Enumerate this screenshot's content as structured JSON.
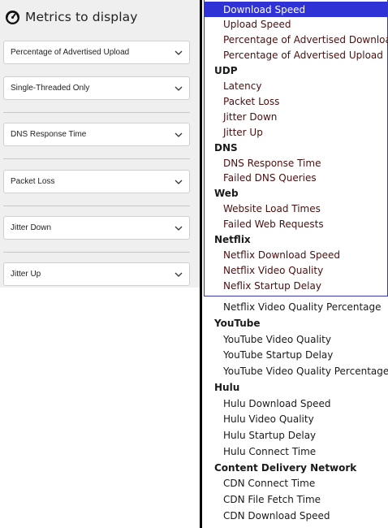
{
  "settings_panel": {
    "title": "Metrics to display",
    "icon": "gauge-icon",
    "selects": [
      {
        "value": "Percentage of Advertised Upload"
      },
      {
        "value": "Single-Threaded Only"
      },
      {
        "value": "DNS Response Time"
      },
      {
        "value": "Packet Loss"
      },
      {
        "value": "Jitter Down"
      },
      {
        "value": "Jitter Up"
      }
    ]
  },
  "dropdown": {
    "selected": "Download Speed",
    "rows": [
      {
        "kind": "item",
        "label": "Download Speed"
      },
      {
        "kind": "item",
        "label": "Upload Speed"
      },
      {
        "kind": "item",
        "label": "Percentage of Advertised Download"
      },
      {
        "kind": "item",
        "label": "Percentage of Advertised Upload"
      },
      {
        "kind": "group",
        "label": "UDP"
      },
      {
        "kind": "item",
        "label": "Latency"
      },
      {
        "kind": "item",
        "label": "Packet Loss"
      },
      {
        "kind": "item",
        "label": "Jitter Down"
      },
      {
        "kind": "item",
        "label": "Jitter Up"
      },
      {
        "kind": "group",
        "label": "DNS"
      },
      {
        "kind": "item",
        "label": "DNS Response Time"
      },
      {
        "kind": "item",
        "label": "Failed DNS Queries"
      },
      {
        "kind": "group",
        "label": "Web"
      },
      {
        "kind": "item",
        "label": "Website Load Times"
      },
      {
        "kind": "item",
        "label": "Failed Web Requests"
      },
      {
        "kind": "group",
        "label": "Netflix"
      },
      {
        "kind": "item",
        "label": "Netflix Download Speed"
      },
      {
        "kind": "item",
        "label": "Netflix Video Quality"
      },
      {
        "kind": "item",
        "label": "Neflix Startup Delay"
      }
    ],
    "continuation": [
      {
        "kind": "item",
        "label": "Netflix Video Quality Percentage"
      },
      {
        "kind": "group",
        "label": "YouTube"
      },
      {
        "kind": "item",
        "label": "YouTube Video Quality"
      },
      {
        "kind": "item",
        "label": "YouTube Startup Delay"
      },
      {
        "kind": "item",
        "label": "YouTube Video Quality Percentage"
      },
      {
        "kind": "group",
        "label": "Hulu"
      },
      {
        "kind": "item",
        "label": "Hulu Download Speed"
      },
      {
        "kind": "item",
        "label": "Hulu Video Quality"
      },
      {
        "kind": "item",
        "label": "Hulu Startup Delay"
      },
      {
        "kind": "item",
        "label": "Hulu Connect Time"
      },
      {
        "kind": "group",
        "label": "Content Delivery Network"
      },
      {
        "kind": "item",
        "label": "CDN Connect Time"
      },
      {
        "kind": "item",
        "label": "CDN File Fetch Time"
      },
      {
        "kind": "item",
        "label": "CDN Download Speed"
      }
    ]
  },
  "colors": {
    "selected_bg": "#2f33d6",
    "item_text": "#4a1010",
    "panel_bg": "#efefef",
    "border": "#3b3aa0"
  }
}
